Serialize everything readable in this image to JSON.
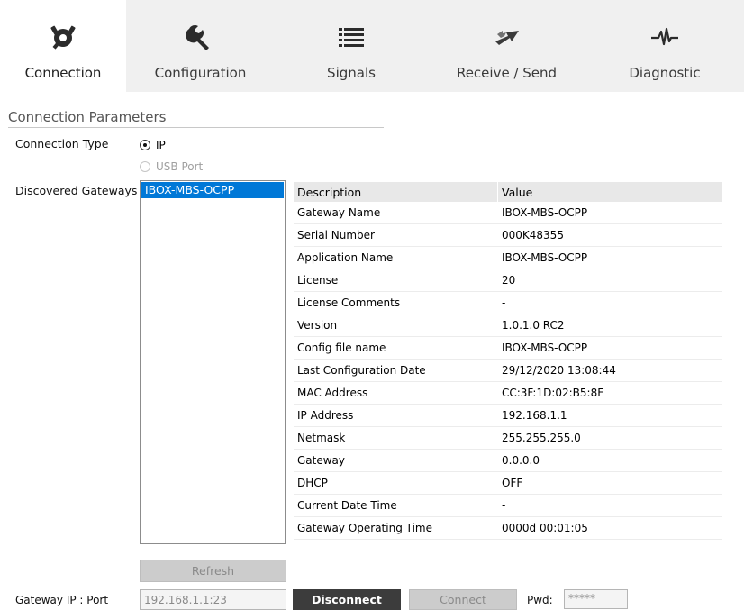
{
  "tabs": [
    {
      "label": "Connection",
      "icon": "plug-icon"
    },
    {
      "label": "Configuration",
      "icon": "wrench-icon"
    },
    {
      "label": "Signals",
      "icon": "list-icon"
    },
    {
      "label": "Receive / Send",
      "icon": "arrows-icon"
    },
    {
      "label": "Diagnostic",
      "icon": "waveform-icon"
    }
  ],
  "section": {
    "title": "Connection Parameters"
  },
  "connection_type": {
    "label": "Connection Type",
    "options": [
      {
        "label": "IP",
        "checked": true
      },
      {
        "label": "USB Port",
        "checked": false
      }
    ]
  },
  "gateways": {
    "label": "Discovered Gateways",
    "items": [
      "IBOX-MBS-OCPP"
    ]
  },
  "table": {
    "headers": [
      "Description",
      "Value"
    ],
    "rows": [
      [
        "Gateway Name",
        "IBOX-MBS-OCPP"
      ],
      [
        "Serial Number",
        "000K48355"
      ],
      [
        "Application Name",
        "IBOX-MBS-OCPP"
      ],
      [
        "License",
        "20"
      ],
      [
        "License Comments",
        "-"
      ],
      [
        "Version",
        "1.0.1.0 RC2"
      ],
      [
        "Config file name",
        "IBOX-MBS-OCPP"
      ],
      [
        "Last Configuration Date",
        "29/12/2020 13:08:44"
      ],
      [
        "MAC Address",
        "CC:3F:1D:02:B5:8E"
      ],
      [
        "IP Address",
        "192.168.1.1"
      ],
      [
        "Netmask",
        "255.255.255.0"
      ],
      [
        "Gateway",
        "0.0.0.0"
      ],
      [
        "DHCP",
        "OFF"
      ],
      [
        "Current Date Time",
        "-"
      ],
      [
        "Gateway Operating Time",
        "0000d 00:01:05"
      ]
    ]
  },
  "refresh_label": "Refresh",
  "gateway_ip": {
    "label": "Gateway IP : Port",
    "value": "192.168.1.1:23"
  },
  "disconnect_label": "Disconnect",
  "connect_label": "Connect",
  "pwd": {
    "label": "Pwd:",
    "value": "*****"
  },
  "colors": {
    "accent": "#0078d7",
    "tab_bg": "#f0f0f0",
    "dark_button": "#3c3c3c"
  }
}
